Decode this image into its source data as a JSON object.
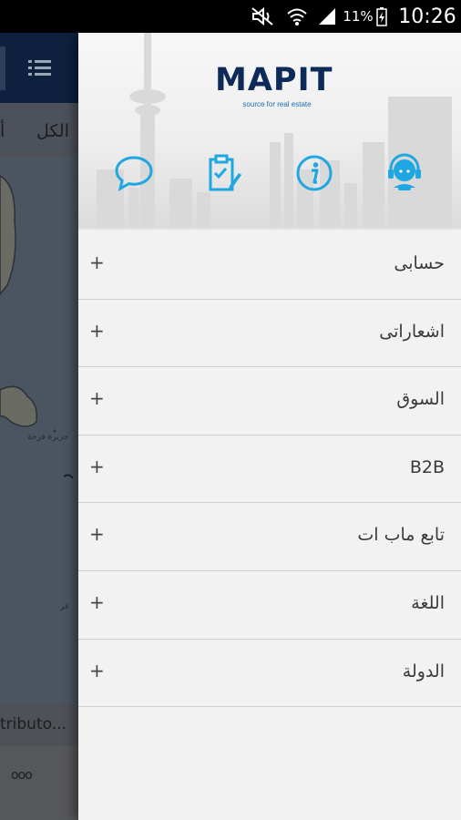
{
  "status_bar": {
    "battery_percent": "11%",
    "time": "10:26",
    "icons": [
      "mute-icon",
      "wifi-icon",
      "signal-icon",
      "battery-charging-icon"
    ]
  },
  "background_app": {
    "filter_all": "الكل",
    "filter_other": "أ",
    "map_labels": [
      "جزيرة فرحة",
      "غر"
    ],
    "caption": "tributo...",
    "more": "ooo"
  },
  "drawer": {
    "logo": "MAPIT",
    "tagline": "source for real estate",
    "header_icons": [
      "chat-icon",
      "report-icon",
      "info-icon",
      "support-icon"
    ],
    "menu": [
      {
        "label": "حسابى",
        "expand": "+"
      },
      {
        "label": "اشعاراتى",
        "expand": "+"
      },
      {
        "label": "السوق",
        "expand": "+"
      },
      {
        "label": "B2B",
        "expand": "+"
      },
      {
        "label": "تابع ماب ات",
        "expand": "+"
      },
      {
        "label": "اللغة",
        "expand": "+"
      },
      {
        "label": "الدولة",
        "expand": "+"
      }
    ]
  },
  "colors": {
    "accent": "#1ea7e1",
    "brand_navy": "#0e2a58",
    "drawer_bg": "#f2f2f2"
  }
}
